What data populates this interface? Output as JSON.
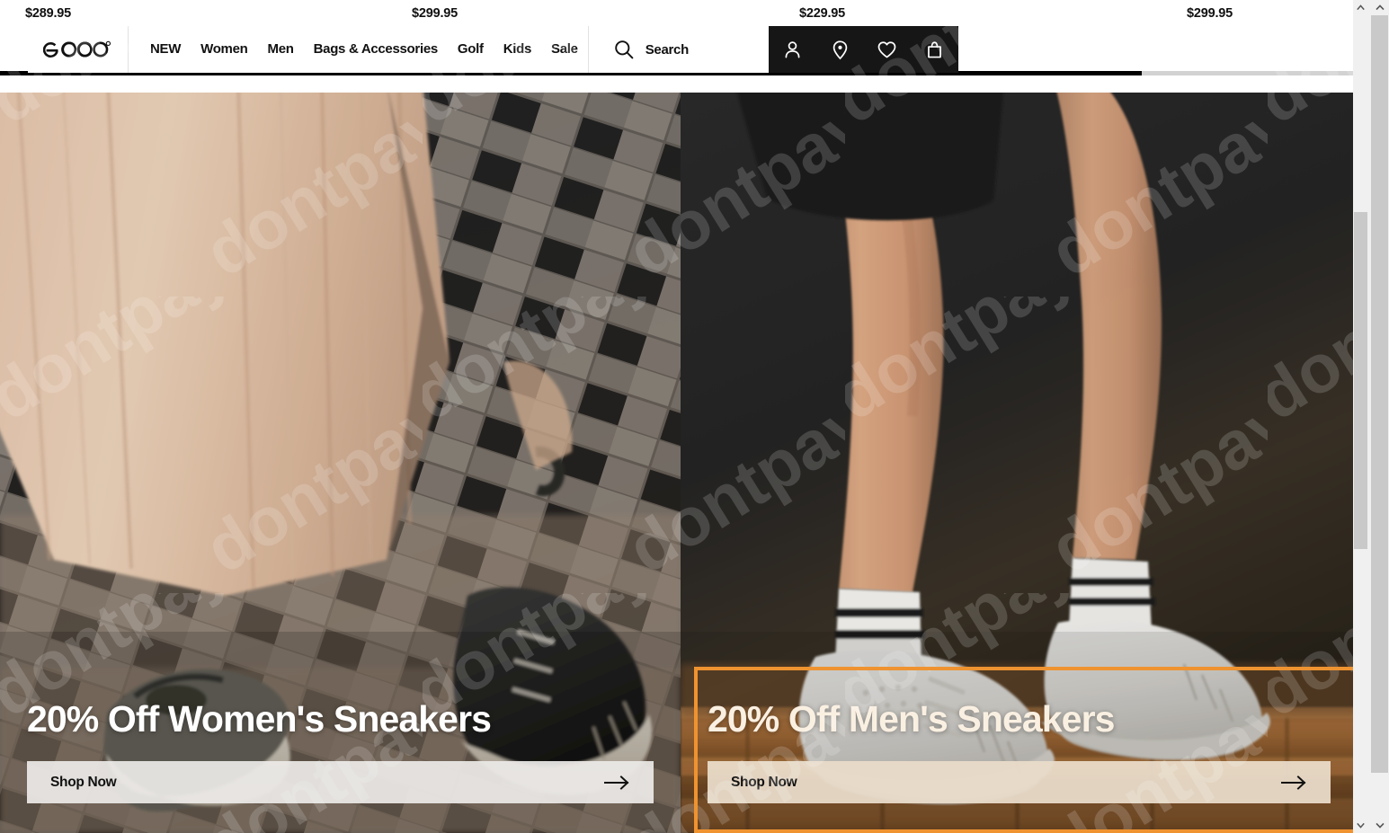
{
  "top_prices": [
    "$289.95",
    "$299.95",
    "$229.95",
    "$299.95"
  ],
  "header": {
    "logo_text": "ecco",
    "logo_trademark": "®",
    "nav_items": [
      {
        "label": "NEW",
        "name": "nav-new"
      },
      {
        "label": "Women",
        "name": "nav-women"
      },
      {
        "label": "Men",
        "name": "nav-men"
      },
      {
        "label": "Bags & Accessories",
        "name": "nav-bags-accessories"
      },
      {
        "label": "Golf",
        "name": "nav-golf"
      },
      {
        "label": "Kids",
        "name": "nav-kids"
      },
      {
        "label": "Sale",
        "name": "nav-sale"
      }
    ],
    "search_label": "Search",
    "icons": [
      {
        "name": "account-icon",
        "title": "Account"
      },
      {
        "name": "store-locator-icon",
        "title": "Store locator"
      },
      {
        "name": "wishlist-heart-icon",
        "title": "Wishlist"
      },
      {
        "name": "shopping-bag-icon",
        "title": "Bag"
      }
    ]
  },
  "banners": [
    {
      "id": "women",
      "heading": "20% Off Women's Sneakers",
      "cta_label": "Shop Now",
      "highlighted": false
    },
    {
      "id": "men",
      "heading": "20% Off Men's Sneakers",
      "cta_label": "Shop Now",
      "highlighted": true
    }
  ],
  "watermark": {
    "text": "dontpayfull"
  },
  "colors": {
    "highlight_border": "#ef9330",
    "icon_panel_bg": "#161616",
    "progress_fill": "#000000",
    "progress_track": "#d2d2d2",
    "women_cta_bg": "#eceae7",
    "men_cta_bg": "#e9dbc9",
    "scrollbar_thumb": "#c9c9c9",
    "scrollbar_track": "#f0f0f0"
  },
  "carousel": {
    "progress_percent": 84
  }
}
